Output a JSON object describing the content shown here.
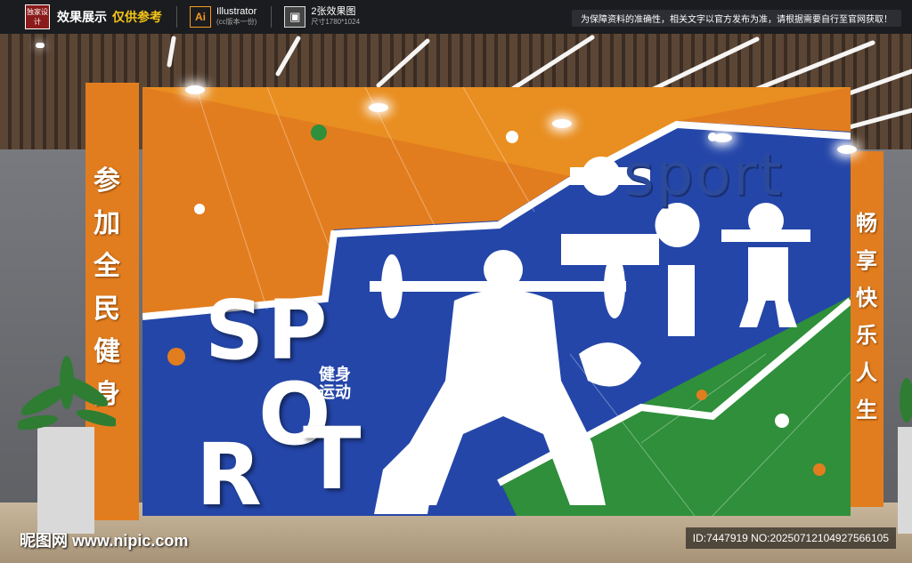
{
  "header": {
    "logo_text": "独家设计",
    "title": "效果展示",
    "reference": "仅供参考",
    "ai_icon": "Ai",
    "software": "Illustrator",
    "software_sub": "(cc版本一份)",
    "image_icon": "image-icon",
    "image_count": "2张效果图",
    "image_size": "尺寸1780*1024",
    "notice": "为保障资料的准确性，相关文字以官方发布为准，请根据需要自行至官网获取！"
  },
  "mural": {
    "left_slogan": [
      "参",
      "加",
      "全",
      "民",
      "健",
      "身"
    ],
    "right_slogan": [
      "畅",
      "享",
      "快",
      "乐",
      "人",
      "生"
    ],
    "big_letters": [
      "S",
      "P",
      "O",
      "R",
      "T"
    ],
    "sub_label": "健身运动",
    "sign_word": "sport",
    "colors": {
      "orange": "#e27d1f",
      "blue": "#2446a8",
      "green": "#2f8f3a",
      "white": "#ffffff"
    }
  },
  "watermark": {
    "site": "昵图网 www.nipic.com",
    "id_line": "ID:7447919 NO:20250712104927566105"
  }
}
